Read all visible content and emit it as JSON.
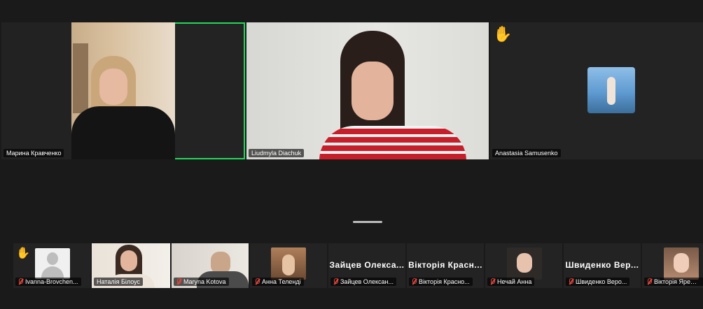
{
  "main_tiles": [
    {
      "name": "Марина Кравченко",
      "active": true
    },
    {
      "name": "Liudmyla Diachuk",
      "active": false
    },
    {
      "name": "Anastasia Samusenko",
      "active": false,
      "hand_raised": true
    }
  ],
  "strip_tiles": [
    {
      "name": "Ivanna-Brovchen...",
      "muted": true,
      "hand_raised": true,
      "video": "placeholder-avatar"
    },
    {
      "name": "Наталія Білоус",
      "muted": false,
      "video": "camera"
    },
    {
      "name": "Maryna Kotova",
      "muted": true,
      "video": "camera"
    },
    {
      "name": "Анна Теленді",
      "muted": true,
      "video": "thumbnail"
    },
    {
      "name": "Зайцев Олексан...",
      "muted": true,
      "display_name": "Зайцев Олекса...",
      "video": "none"
    },
    {
      "name": "Вікторія Красно...",
      "muted": true,
      "display_name": "Вікторія Красн...",
      "video": "none"
    },
    {
      "name": "Нечай Анна",
      "muted": true,
      "video": "thumbnail"
    },
    {
      "name": "Швиденко Веро...",
      "muted": true,
      "display_name": "Швиденко Вер...",
      "video": "none"
    },
    {
      "name": "Вікторія Яремен...",
      "muted": true,
      "video": "thumbnail"
    }
  ],
  "colors": {
    "active_border": "#23d959",
    "muted_icon": "#e0463e",
    "hand": "#f5c518"
  },
  "icons": {
    "hand": "raised-hand-icon",
    "mic_off": "mic-muted-icon"
  }
}
